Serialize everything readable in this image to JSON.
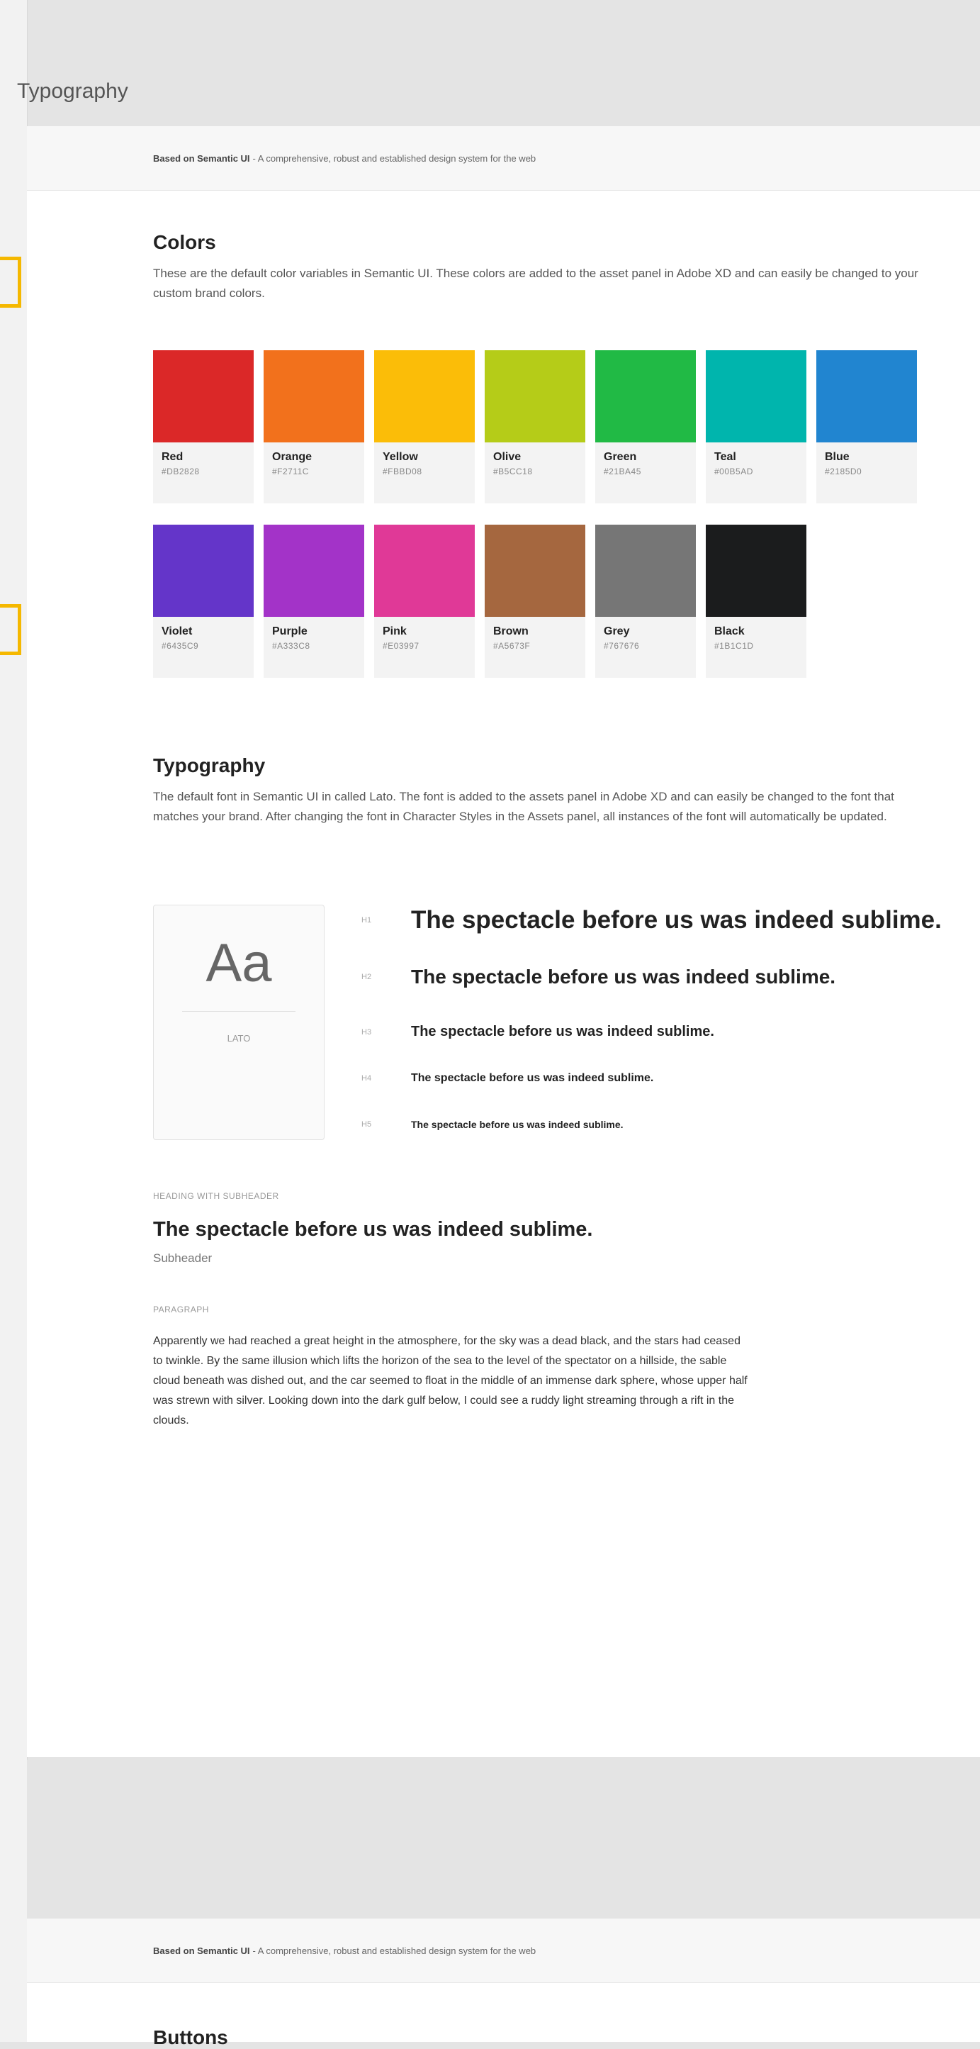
{
  "artboard": {
    "title": "Typography"
  },
  "banner": {
    "bold": "Based on Semantic UI",
    "text": " - A comprehensive, robust and established design system for the web"
  },
  "colors": {
    "heading": "Colors",
    "description": "These are the default color variables in Semantic UI. These colors are added to the asset panel in Adobe XD and can easily be changed to your custom brand colors.",
    "row1": [
      {
        "name": "Red",
        "hex": "#DB2828",
        "color": "#DB2828"
      },
      {
        "name": "Orange",
        "hex": "#F2711C",
        "color": "#F2711C"
      },
      {
        "name": "Yellow",
        "hex": "#FBBD08",
        "color": "#FBBD08"
      },
      {
        "name": "Olive",
        "hex": "#B5CC18",
        "color": "#B5CC18"
      },
      {
        "name": "Green",
        "hex": "#21BA45",
        "color": "#21BA45"
      },
      {
        "name": "Teal",
        "hex": "#00B5AD",
        "color": "#00B5AD"
      },
      {
        "name": "Blue",
        "hex": "#2185D0",
        "color": "#2185D0"
      }
    ],
    "row2": [
      {
        "name": "Violet",
        "hex": "#6435C9",
        "color": "#6435C9"
      },
      {
        "name": "Purple",
        "hex": "#A333C8",
        "color": "#A333C8"
      },
      {
        "name": "Pink",
        "hex": "#E03997",
        "color": "#E03997"
      },
      {
        "name": "Brown",
        "hex": "#A5673F",
        "color": "#A5673F"
      },
      {
        "name": "Grey",
        "hex": "#767676",
        "color": "#767676"
      },
      {
        "name": "Black",
        "hex": "#1B1C1D",
        "color": "#1B1C1D"
      }
    ]
  },
  "typography": {
    "heading": "Typography",
    "description": "The default font in Semantic UI in called Lato. The font is added to the assets panel in Adobe XD and can easily be changed to the font that matches your brand. After changing the font in Character Styles in the Assets panel, all instances of the font will automatically be updated.",
    "font_card": {
      "sample": "Aa",
      "font_name": "LATO"
    },
    "headings": [
      {
        "tag": "H1",
        "text": "The spectacle before us was indeed sublime."
      },
      {
        "tag": "H2",
        "text": "The spectacle before us was indeed sublime."
      },
      {
        "tag": "H3",
        "text": "The spectacle before us was indeed sublime."
      },
      {
        "tag": "H4",
        "text": "The spectacle before us was indeed sublime."
      },
      {
        "tag": "H5",
        "text": "The spectacle before us was indeed sublime."
      }
    ],
    "subheader_block": {
      "label": "HEADING WITH SUBHEADER",
      "heading": "The spectacle before us was indeed sublime.",
      "subheader": "Subheader"
    },
    "paragraph_block": {
      "label": "PARAGRAPH",
      "text": "Apparently we had reached a great height in the atmosphere, for the sky was a dead black, and the stars had ceased to twinkle. By the same illusion which lifts the horizon of the sea to the level of the spectator on a hillside, the sable cloud beneath was dished out, and the car seemed to float in the middle of an immense dark sphere, whose upper half was strewn with silver. Looking down into the dark gulf below, I could see a ruddy light streaming through a rift in the clouds."
    }
  },
  "next_section": {
    "heading": "Buttons"
  }
}
